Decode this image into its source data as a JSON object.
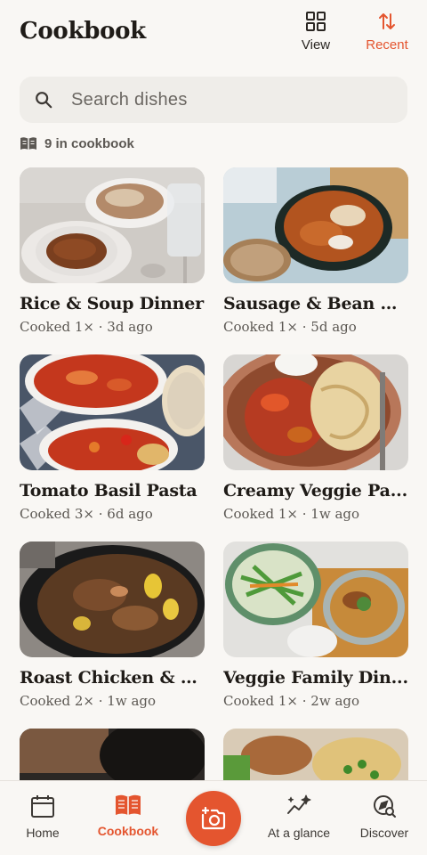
{
  "header": {
    "title": "Cookbook",
    "view_label": "View",
    "recent_label": "Recent",
    "view_icon": "grid-icon",
    "recent_icon": "sort-arrows-icon"
  },
  "search": {
    "placeholder": "Search dishes",
    "value": ""
  },
  "count": {
    "icon": "open-book-icon",
    "text": "9 in cookbook"
  },
  "recipes": [
    {
      "title": "Rice & Soup Dinner",
      "meta": "Cooked 1× · 3d ago"
    },
    {
      "title": "Sausage & Bean St...",
      "meta": "Cooked 1× · 5d ago"
    },
    {
      "title": "Tomato Basil Pasta",
      "meta": "Cooked 3× · 6d ago"
    },
    {
      "title": "Creamy Veggie Pa...",
      "meta": "Cooked 1× · 1w ago"
    },
    {
      "title": "Roast Chicken & P...",
      "meta": "Cooked 2× · 1w ago"
    },
    {
      "title": "Veggie Family Din...",
      "meta": "Cooked 1× · 2w ago"
    }
  ],
  "bottom_nav": {
    "items": [
      {
        "label": "Home",
        "icon": "calendar-icon"
      },
      {
        "label": "Cookbook",
        "icon": "open-book-icon"
      },
      {
        "label": "At a glance",
        "icon": "sparkle-trend-icon"
      },
      {
        "label": "Discover",
        "icon": "compass-search-icon"
      }
    ],
    "active": "Cookbook",
    "fab_icon": "add-camera-icon"
  },
  "colors": {
    "accent": "#e4552f",
    "background": "#f9f7f4",
    "search_bg": "#efede9"
  }
}
